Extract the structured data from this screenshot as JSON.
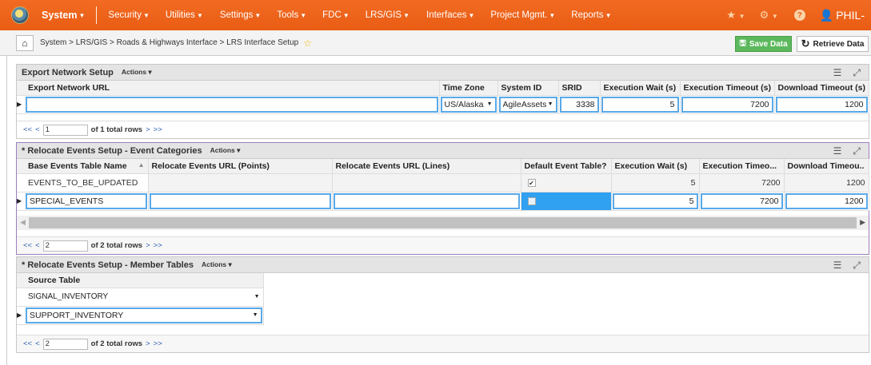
{
  "nav": {
    "system": "System",
    "security": "Security",
    "utilities": "Utilities",
    "settings": "Settings",
    "tools": "Tools",
    "fdc": "FDC",
    "lrsgis": "LRS/GIS",
    "interfaces": "Interfaces",
    "project": "Project Mgmt.",
    "reports": "Reports",
    "user": "PHIL-"
  },
  "breadcrumb": "System > LRS/GIS > Roads & Highways Interface > LRS Interface Setup",
  "toolbar": {
    "save": "Save Data",
    "retrieve": "Retrieve Data"
  },
  "export": {
    "title": "Export Network Setup",
    "actions": "Actions ▾",
    "headers": [
      "Export Network URL",
      "Time Zone",
      "System ID",
      "SRID",
      "Execution Wait (s)",
      "Execution Timeout (s)",
      "Download Timeout (s)"
    ],
    "row": {
      "url": "",
      "tz": "US/Alaska",
      "sysid": "AgileAssets",
      "srid": "3338",
      "wait": "5",
      "timeout": "7200",
      "download": "1200"
    },
    "pager": {
      "first": "<<",
      "prev": "<",
      "page": "1",
      "info": "of 1 total rows",
      "next": ">",
      "last": ">>"
    }
  },
  "categories": {
    "title": "* Relocate Events Setup - Event Categories",
    "actions": "Actions ▾",
    "headers": [
      "Base Events Table Name",
      "Relocate Events URL (Points)",
      "Relocate Events URL (Lines)",
      "Default Event Table?",
      "Execution Wait (s)",
      "Execution Timeo...",
      "Download Timeou.."
    ],
    "rows": [
      {
        "name": "EVENTS_TO_BE_UPDATED",
        "points": "",
        "lines": "",
        "default": "✔",
        "wait": "5",
        "timeout": "7200",
        "download": "1200"
      },
      {
        "name": "SPECIAL_EVENTS",
        "points": "",
        "lines": "",
        "default": "",
        "wait": "5",
        "timeout": "7200",
        "download": "1200"
      }
    ],
    "pager": {
      "first": "<<",
      "prev": "<",
      "page": "2",
      "info": "of 2 total rows",
      "next": ">",
      "last": ">>"
    }
  },
  "members": {
    "title": "* Relocate Events Setup - Member Tables",
    "actions": "Actions ▾",
    "header": "Source Table",
    "rows": [
      "SIGNAL_INVENTORY",
      "SUPPORT_INVENTORY"
    ],
    "pager": {
      "first": "<<",
      "prev": "<",
      "page": "2",
      "info": "of 2 total rows",
      "next": ">",
      "last": ">>"
    }
  },
  "colors": {
    "nav": "#ef6a1f",
    "accent": "#59a9e8",
    "save": "#5cb85c",
    "selected": "#30a0f0"
  }
}
